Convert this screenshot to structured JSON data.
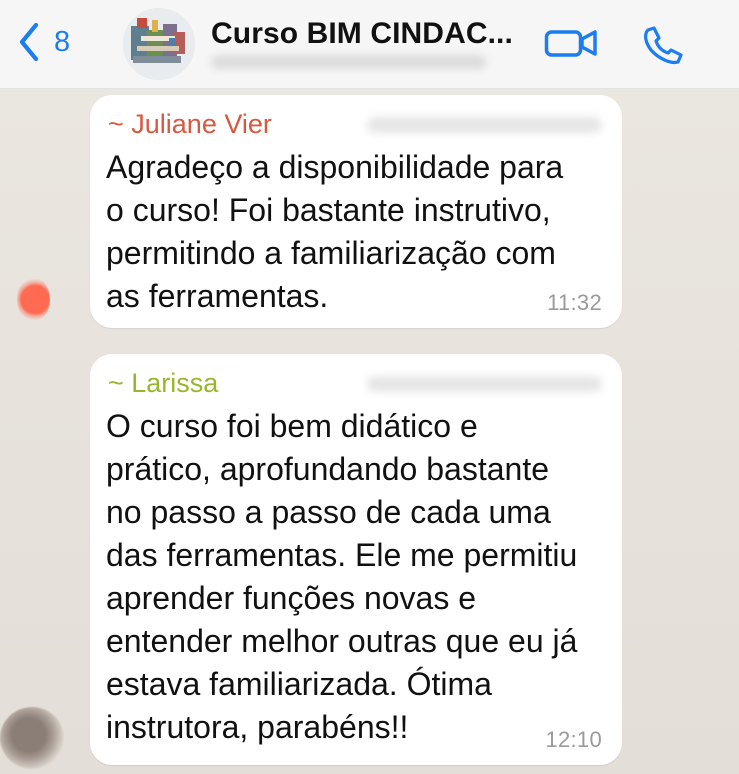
{
  "header": {
    "back_count": "8",
    "title": "Curso BIM CINDAC..."
  },
  "messages": [
    {
      "sender": "~ Juliane Vier",
      "text": "Agradeço a disponibilidade para\no curso! Foi bastante instrutivo,\npermitindo a familiarização com\nas ferramentas.",
      "time": "11:32"
    },
    {
      "sender": "~ Larissa",
      "text": "O curso foi bem didático e\nprático, aprofundando bastante\nno passo a passo de cada uma\ndas ferramentas. Ele me permitiu\naprender funções novas e\nentender melhor outras que eu já\nestava familiarizada. Ótima\ninstrutora, parabéns!!",
      "time": "12:10"
    }
  ],
  "colors": {
    "accent": "#1b7df0",
    "sender_juliane": "#d8593f",
    "sender_larissa": "#98b629",
    "bubble": "#ffffff",
    "background": "#e7e3dd"
  },
  "icons": {
    "back": "chevron-left-icon",
    "video": "video-icon",
    "call": "phone-icon"
  }
}
